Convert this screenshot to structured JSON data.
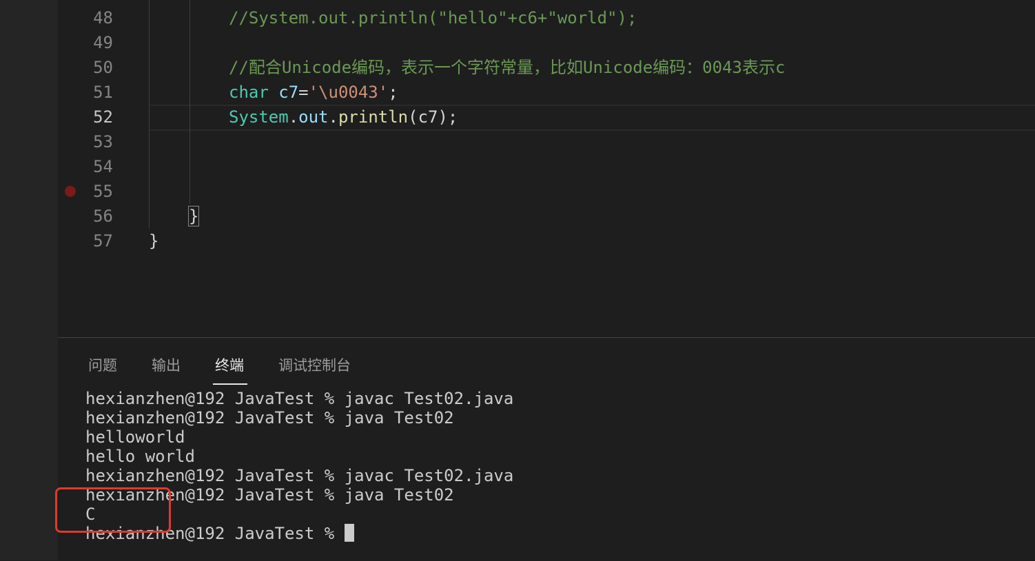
{
  "editor": {
    "line_numbers": [
      "48",
      "49",
      "50",
      "51",
      "52",
      "53",
      "54",
      "55",
      "56",
      "57"
    ],
    "active_line": "52",
    "code": {
      "line48": "//System.out.println(\"hello\"+c6+\"world\");",
      "line50": "//配合Unicode编码，表示一个字符常量，比如Unicode编码：0043表示c",
      "line51": {
        "keyword": "char",
        "var": "c7",
        "op": "=",
        "string": "'\\u0043'",
        "end": ";"
      },
      "line52": {
        "cls": "System",
        "dot1": ".",
        "field": "out",
        "dot2": ".",
        "method": "println",
        "args": "(c7);"
      },
      "line56": "}",
      "line57": "}"
    }
  },
  "panel": {
    "tabs": [
      "问题",
      "输出",
      "终端",
      "调试控制台"
    ],
    "active_tab": "终端",
    "terminal_lines": [
      "hexianzhen@192 JavaTest % javac Test02.java",
      "hexianzhen@192 JavaTest % java Test02",
      "helloworld",
      "hello\tworld",
      "hexianzhen@192 JavaTest % javac Test02.java",
      "hexianzhen@192 JavaTest % java Test02",
      "C",
      "hexianzhen@192 JavaTest % "
    ]
  },
  "colors": {
    "background": "#1e1e1e",
    "comment": "#6a9955",
    "keyword": "#4ec9b0",
    "variable": "#9cdcfe",
    "string": "#ce9178",
    "method": "#dcdcaa",
    "annotation_box": "#e0392b"
  }
}
